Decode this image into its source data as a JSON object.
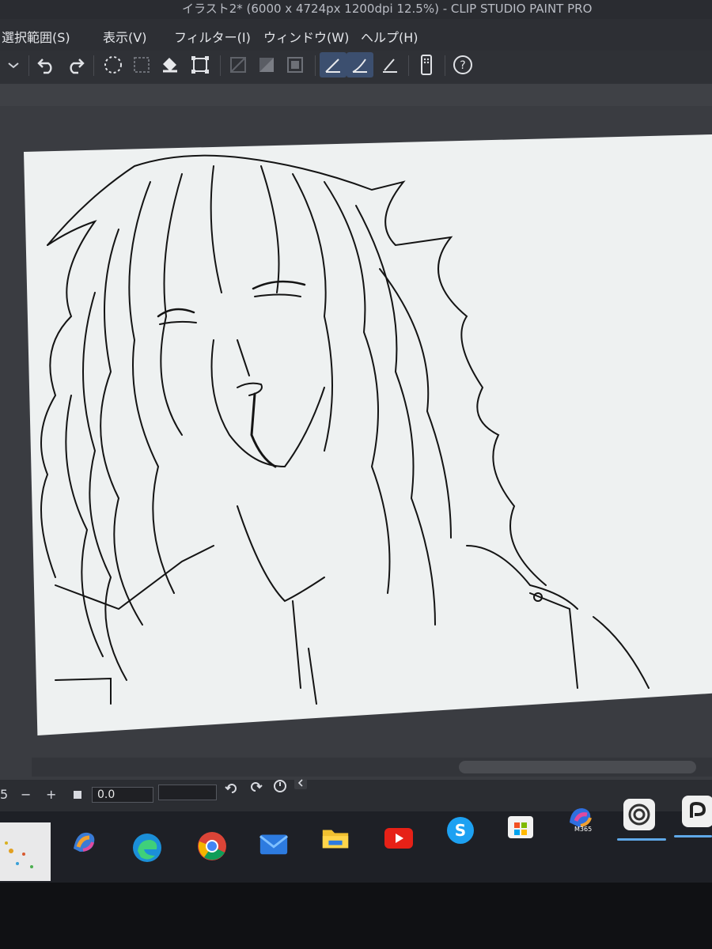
{
  "window": {
    "title": "イラスト2* (6000 x 4724px 1200dpi 12.5%)  - CLIP STUDIO PAINT PRO"
  },
  "menu": {
    "items": [
      {
        "label": "選択範囲(S)"
      },
      {
        "label": "表示(V)"
      },
      {
        "label": "フィルター(I)"
      },
      {
        "label": "ウィンドウ(W)"
      },
      {
        "label": "ヘルプ(H)"
      }
    ]
  },
  "toolbar": {
    "icons": [
      "chevron-down-icon",
      "undo-icon",
      "redo-icon",
      "select-all-icon",
      "deselect-icon",
      "fill-icon",
      "transform-icon",
      "hide-selection-icon",
      "invert-selection-icon",
      "expand-selection-icon",
      "snap-ruler-icon",
      "snap-special-ruler-icon",
      "snap-grid-icon",
      "device-icon",
      "help-icon"
    ]
  },
  "status": {
    "zoom_partial": "5",
    "minus": "−",
    "plus": "+",
    "angle_value": "0.0"
  },
  "taskbar": {
    "apps": [
      "copilot-icon",
      "edge-icon",
      "chrome-icon",
      "mail-icon",
      "file-explorer-icon",
      "youtube-icon",
      "skype-icon",
      "microsoft-store-icon",
      "m365-icon",
      "clip-studio-icon",
      "clip-studio-paint-icon"
    ],
    "m365_label": "M365"
  },
  "colors": {
    "accent": "#3c4f6f",
    "canvas": "#eef1f1",
    "taskbar_indicator": "#5fa8e8"
  }
}
